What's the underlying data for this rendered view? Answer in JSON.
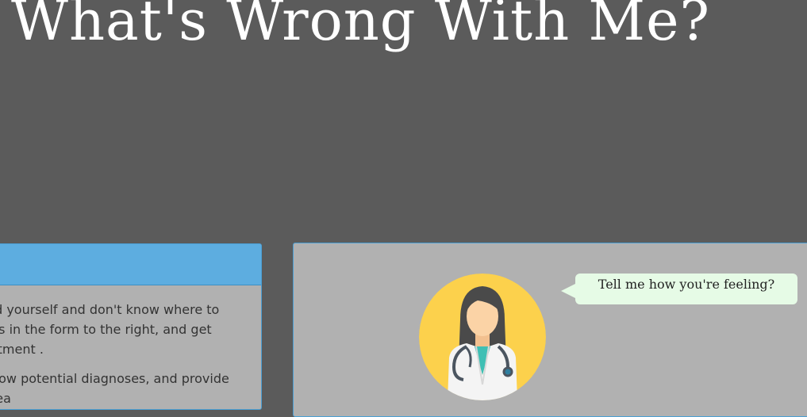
{
  "header": {
    "title": "What's Wrong With Me?"
  },
  "info_panel": {
    "lines": [
      "red yourself and don't know where to",
      "ns in the form to the right, and get",
      "eatment .",
      "how potential diagnoses, and provide",
      "rea"
    ]
  },
  "chat": {
    "bubble_text": "Tell me how you're feeling?",
    "avatar_icon": "doctor-avatar-icon"
  },
  "colors": {
    "background": "#5b5b5b",
    "panel": "#b1b1b1",
    "header_accent": "#5dade0",
    "bubble": "#e6fbe6",
    "avatar_circle": "#fcd14c"
  }
}
